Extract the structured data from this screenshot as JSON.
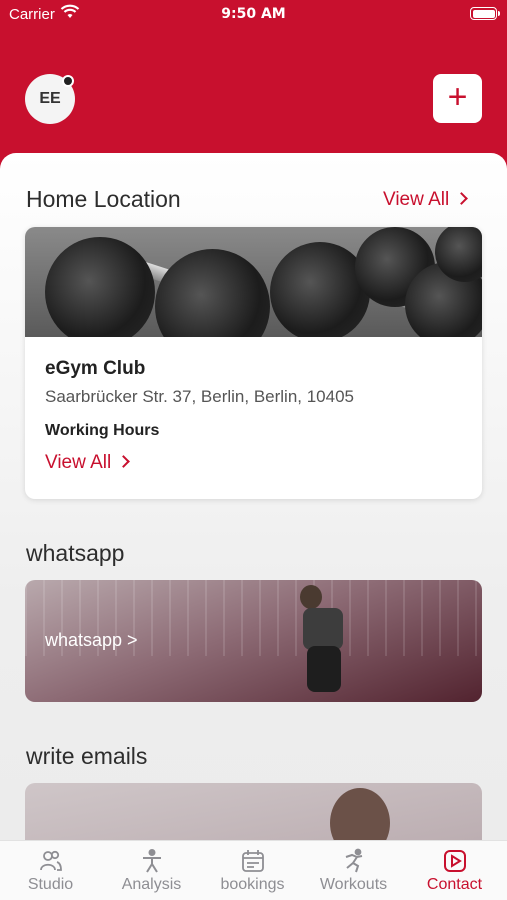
{
  "status_bar": {
    "carrier": "Carrier",
    "time": "9:50 AM"
  },
  "header": {
    "avatar_initials": "EE",
    "add_button": "+"
  },
  "home_location": {
    "title": "Home Location",
    "view_all": "View All",
    "club_name": "eGym Club",
    "address": "Saarbrücker Str. 37, Berlin, Berlin, 10405",
    "working_hours_label": "Working Hours",
    "working_hours_link": "View All"
  },
  "whatsapp": {
    "title": "whatsapp",
    "banner_text": "whatsapp >"
  },
  "emails": {
    "title": "write emails"
  },
  "tabs": [
    {
      "label": "Studio",
      "icon": "people-icon"
    },
    {
      "label": "Analysis",
      "icon": "figure-icon"
    },
    {
      "label": "bookings",
      "icon": "calendar-icon"
    },
    {
      "label": "Workouts",
      "icon": "running-icon"
    },
    {
      "label": "Contact",
      "icon": "play-icon"
    }
  ],
  "colors": {
    "brand": "#c8102e",
    "inactive": "#8e8e93"
  }
}
